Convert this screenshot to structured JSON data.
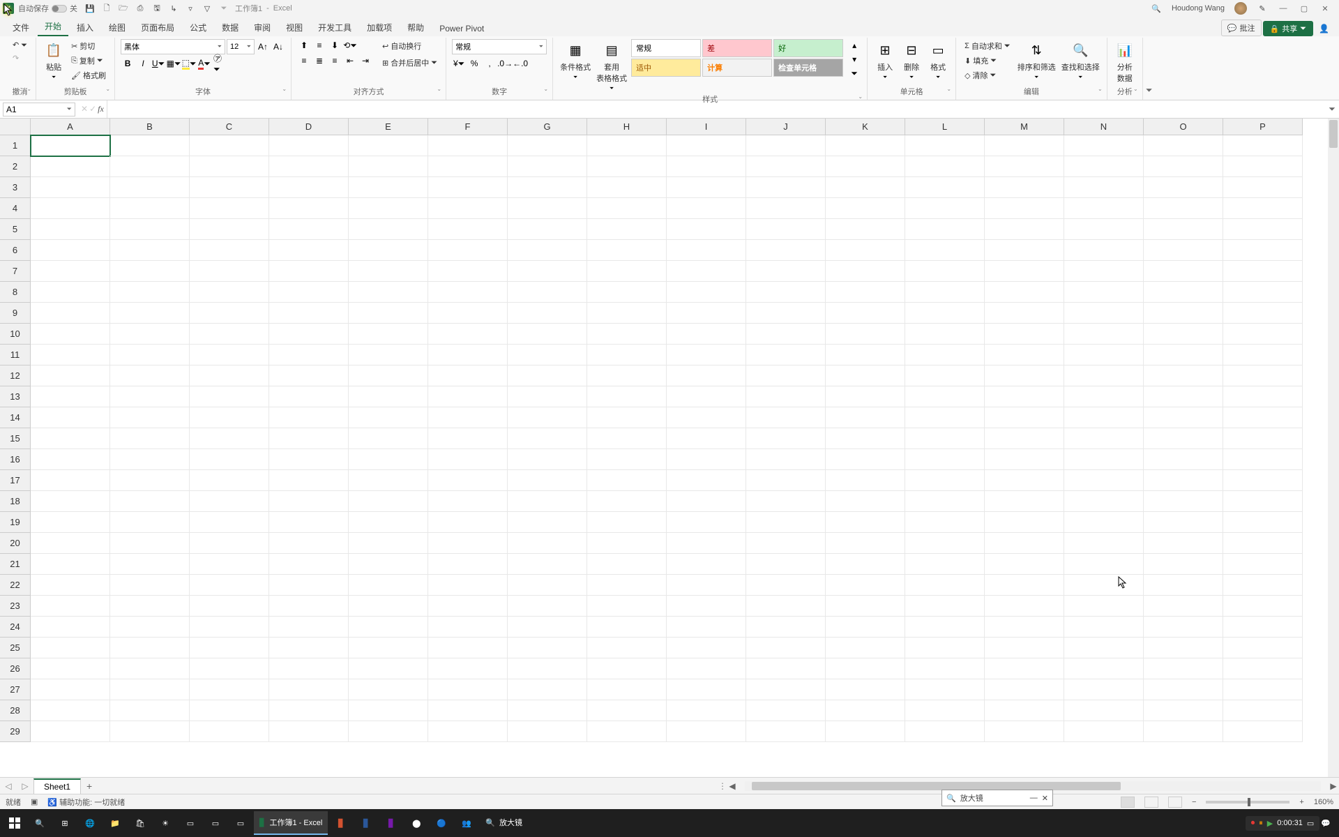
{
  "title": {
    "autosave_label": "自动保存",
    "autosave_state": "关",
    "doc": "工作簿1",
    "sep": "-",
    "app": "Excel",
    "user": "Houdong Wang"
  },
  "tabs": {
    "file": "文件",
    "home": "开始",
    "insert": "插入",
    "draw": "绘图",
    "layout": "页面布局",
    "formulas": "公式",
    "data": "数据",
    "review": "审阅",
    "view": "视图",
    "developer": "开发工具",
    "addins": "加载项",
    "help": "帮助",
    "powerpivot": "Power Pivot",
    "comments": "批注",
    "share": "共享"
  },
  "ribbon": {
    "undo_group": "撤消",
    "clipboard": {
      "paste": "粘贴",
      "cut": "剪切",
      "copy": "复制",
      "painter": "格式刷",
      "label": "剪贴板"
    },
    "font": {
      "name": "黑体",
      "size": "12",
      "label": "字体"
    },
    "align": {
      "wrap": "自动换行",
      "merge": "合并后居中",
      "label": "对齐方式"
    },
    "number": {
      "format": "常规",
      "label": "数字"
    },
    "styles": {
      "cond": "条件格式",
      "table": "套用\n表格格式",
      "s1": "常规",
      "s2": "差",
      "s3": "好",
      "s4": "适中",
      "s5": "计算",
      "s6": "检查单元格",
      "label": "样式"
    },
    "cells": {
      "insert": "插入",
      "delete": "删除",
      "format": "格式",
      "label": "单元格"
    },
    "editing": {
      "sum": "自动求和",
      "fill": "填充",
      "clear": "清除",
      "sort": "排序和筛选",
      "find": "查找和选择",
      "label": "编辑"
    },
    "analysis": {
      "analyze": "分析\n数据",
      "label": "分析"
    }
  },
  "namebox": "A1",
  "columns": [
    "A",
    "B",
    "C",
    "D",
    "E",
    "F",
    "G",
    "H",
    "I",
    "J",
    "K",
    "L",
    "M",
    "N",
    "O",
    "P"
  ],
  "rows": [
    "1",
    "2",
    "3",
    "4",
    "5",
    "6",
    "7",
    "8",
    "9",
    "10",
    "11",
    "12",
    "13",
    "14",
    "15",
    "16",
    "17",
    "18",
    "19",
    "20",
    "21",
    "22",
    "23",
    "24",
    "25",
    "26",
    "27",
    "28",
    "29"
  ],
  "sheet": {
    "name": "Sheet1"
  },
  "status": {
    "ready": "就绪",
    "access": "辅助功能: 一切就绪",
    "zoom": "160%"
  },
  "magnifier": {
    "title": "放大镜"
  },
  "taskbar": {
    "excel": "工作簿1 - Excel",
    "magnifier": "放大镜",
    "rec_time": "0:00:31"
  }
}
